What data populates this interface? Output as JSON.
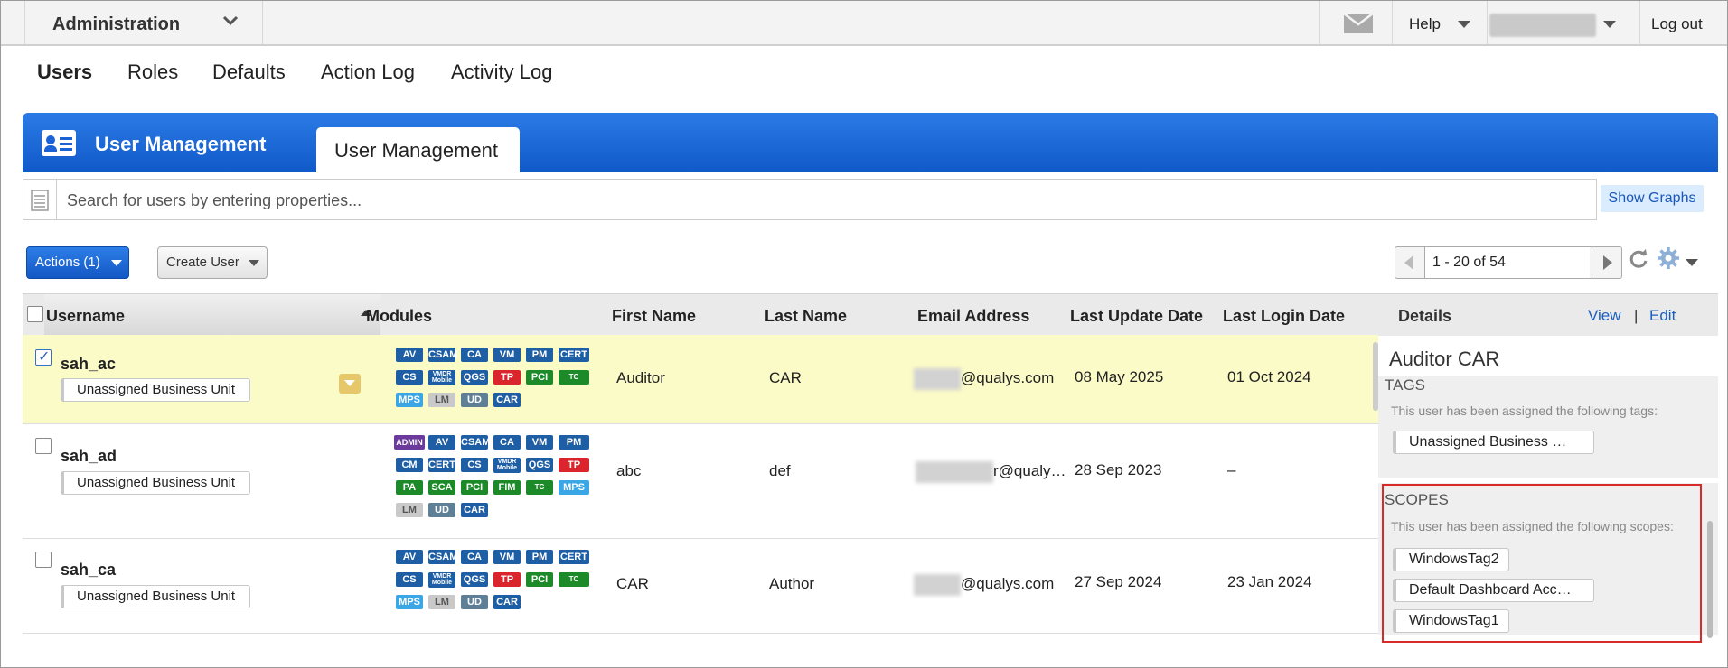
{
  "topbar": {
    "app_title": "Administration",
    "help_label": "Help",
    "logout_label": "Log out"
  },
  "nav": {
    "tabs": [
      "Users",
      "Roles",
      "Defaults",
      "Action Log",
      "Activity Log"
    ],
    "active": "Users"
  },
  "panel": {
    "title": "User Management",
    "tab": "User Management"
  },
  "search": {
    "placeholder": "Search for users by entering properties...",
    "show_graphs": "Show Graphs"
  },
  "toolbar": {
    "actions_label": "Actions (1)",
    "create_label": "Create User",
    "pager_text": "1 - 20 of 54"
  },
  "table": {
    "columns": [
      "Username",
      "Modules",
      "First Name",
      "Last Name",
      "Email Address",
      "Last Update Date",
      "Last Login Date"
    ],
    "rows": [
      {
        "username": "sah_ac",
        "checked": true,
        "business_unit": "Unassigned Business Unit",
        "modules": [
          "AV",
          "CSAM",
          "CA",
          "VM",
          "PM",
          "CERT",
          "CS",
          "VMDR Mobile",
          "QGS",
          "TP",
          "PCI",
          "TC",
          "MPS",
          "LM",
          "UD",
          "CAR"
        ],
        "first_name": "Auditor",
        "last_name": "CAR",
        "email": "@qualys.com",
        "last_update": "08 May 2025",
        "last_login": "01 Oct 2024"
      },
      {
        "username": "sah_ad",
        "checked": false,
        "business_unit": "Unassigned Business Unit",
        "modules": [
          "ADMIN",
          "AV",
          "CSAM",
          "CA",
          "VM",
          "PM",
          "CM",
          "CERT",
          "CS",
          "VMDR Mobile",
          "QGS",
          "TP",
          "PA",
          "SCA",
          "PCI",
          "FIM",
          "TC",
          "MPS",
          "LM",
          "UD",
          "CAR"
        ],
        "first_name": "abc",
        "last_name": "def",
        "email": "r@qualy…",
        "last_update": "28 Sep 2023",
        "last_login": "–"
      },
      {
        "username": "sah_ca",
        "checked": false,
        "business_unit": "Unassigned Business Unit",
        "modules": [
          "AV",
          "CSAM",
          "CA",
          "VM",
          "PM",
          "CERT",
          "CS",
          "VMDR Mobile",
          "QGS",
          "TP",
          "PCI",
          "TC",
          "MPS",
          "LM",
          "UD",
          "CAR"
        ],
        "first_name": "CAR",
        "last_name": "Author",
        "email": "@qualys.com",
        "last_update": "27 Sep 2024",
        "last_login": "23 Jan 2024"
      }
    ]
  },
  "details": {
    "header": "Details",
    "view": "View",
    "separator": "|",
    "edit": "Edit",
    "name": "Auditor CAR",
    "tags_heading": "TAGS",
    "tags_text": "This user has been assigned the following tags:",
    "tags": [
      "Unassigned Business …"
    ],
    "scopes_heading": "SCOPES",
    "scopes_text": "This user has been assigned the following scopes:",
    "scopes": [
      "WindowsTag2",
      "Default Dashboard Acc…",
      "WindowsTag1"
    ]
  },
  "icons": {
    "mail": "envelope-icon",
    "refresh": "refresh-icon",
    "settings": "gear-icon"
  },
  "colors": {
    "banner": "#1a62d6",
    "selected_row": "#fbfbc8",
    "link": "#1a5fc0",
    "highlight_box": "#d92a2a"
  }
}
